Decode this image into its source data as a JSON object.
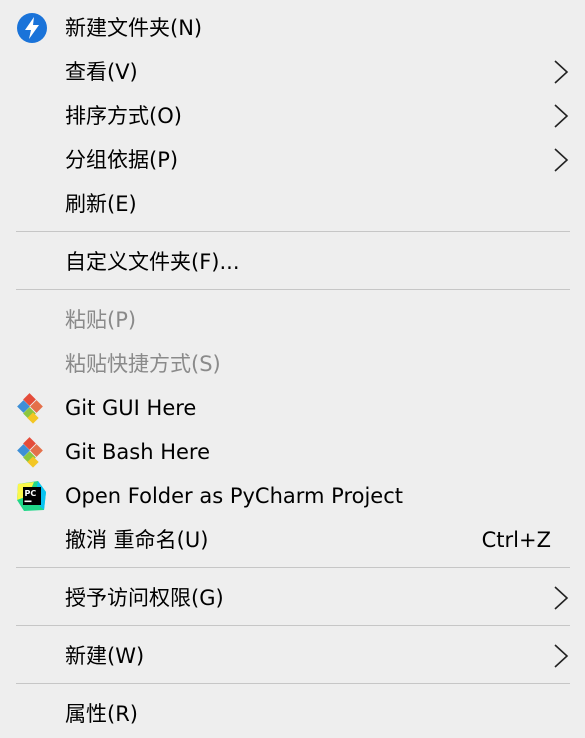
{
  "menu": {
    "new_folder": "新建文件夹(N)",
    "view": "查看(V)",
    "sort_by": "排序方式(O)",
    "group_by": "分组依据(P)",
    "refresh": "刷新(E)",
    "customize_folder": "自定义文件夹(F)...",
    "paste": "粘贴(P)",
    "paste_shortcut": "粘贴快捷方式(S)",
    "git_gui": "Git GUI Here",
    "git_bash": "Git Bash Here",
    "pycharm": "Open Folder as PyCharm Project",
    "undo_rename": "撤消 重命名(U)",
    "undo_shortcut": "Ctrl+Z",
    "give_access": "授予访问权限(G)",
    "new": "新建(W)",
    "properties": "属性(R)"
  },
  "icons": {
    "new_folder": "lightning-bolt-icon",
    "git": "git-diamond-icon",
    "pycharm": "pycharm-icon",
    "submenu": "chevron-right-icon"
  },
  "colors": {
    "menu_bg": "#eeeeee",
    "disabled_text": "#8a8a8a",
    "separator": "#c6c6c6",
    "accent_blue": "#1a73d9"
  }
}
